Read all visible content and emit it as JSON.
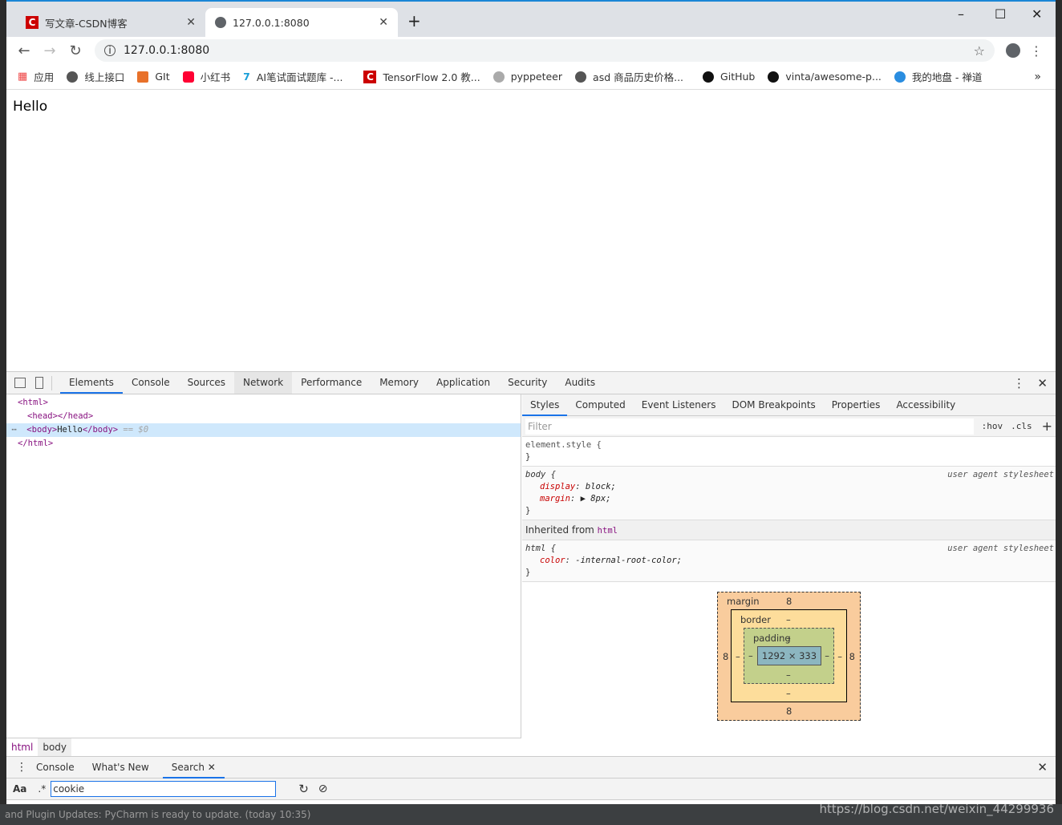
{
  "tabs": [
    {
      "title": "写文章-CSDN博客",
      "icon": "csdn-icon"
    },
    {
      "title": "127.0.0.1:8080",
      "icon": "globe-icon",
      "active": true
    }
  ],
  "address": "127.0.0.1:8080",
  "bookmarks": [
    "应用",
    "线上接口",
    "GIt",
    "小红书",
    "AI笔试面试题库 -...",
    "TensorFlow 2.0 教...",
    "pyppeteer",
    "asd 商品历史价格...",
    "GitHub",
    "vinta/awesome-p...",
    "我的地盘 - 禅道"
  ],
  "page": {
    "text": "Hello"
  },
  "devtools": {
    "tabs": [
      "Elements",
      "Console",
      "Sources",
      "Network",
      "Performance",
      "Memory",
      "Application",
      "Security",
      "Audits"
    ],
    "dom": {
      "l1": "<html>",
      "l2": "<head></head>",
      "l3_open": "<body>",
      "l3_text": "Hello",
      "l3_close": "</body>",
      "l3_ref": " == $0",
      "l4": "</html>"
    },
    "breadcrumbs": [
      "html",
      "body"
    ],
    "side_tabs": [
      "Styles",
      "Computed",
      "Event Listeners",
      "DOM Breakpoints",
      "Properties",
      "Accessibility"
    ],
    "filter_placeholder": "Filter",
    "hov": ":hov",
    "cls": ".cls",
    "rules": {
      "element": "element.style {",
      "close": "}",
      "body_sel": "body {",
      "source": "user agent stylesheet",
      "p1n": "display",
      "p1v": " block;",
      "p2n": "margin",
      "p2v": " ▶ 8px;",
      "inherited": "Inherited from ",
      "inherited_tag": "html",
      "html_sel": "html {",
      "p3n": "color",
      "p3v": " -internal-root-color;"
    },
    "box": {
      "margin_label": "margin",
      "margin": "8",
      "border_label": "border",
      "border": "–",
      "padding_label": "padding",
      "padding": "–",
      "content": "1292 × 333"
    },
    "drawer_tabs": [
      "Console",
      "What's New",
      "Search"
    ],
    "search": {
      "aa": "Aa",
      "regex": ".*",
      "value": "cookie"
    }
  },
  "watermark": "https://blog.csdn.net/weixin_44299936",
  "ide_status": "and Plugin Updates: PyCharm is ready to update. (today 10:35)"
}
